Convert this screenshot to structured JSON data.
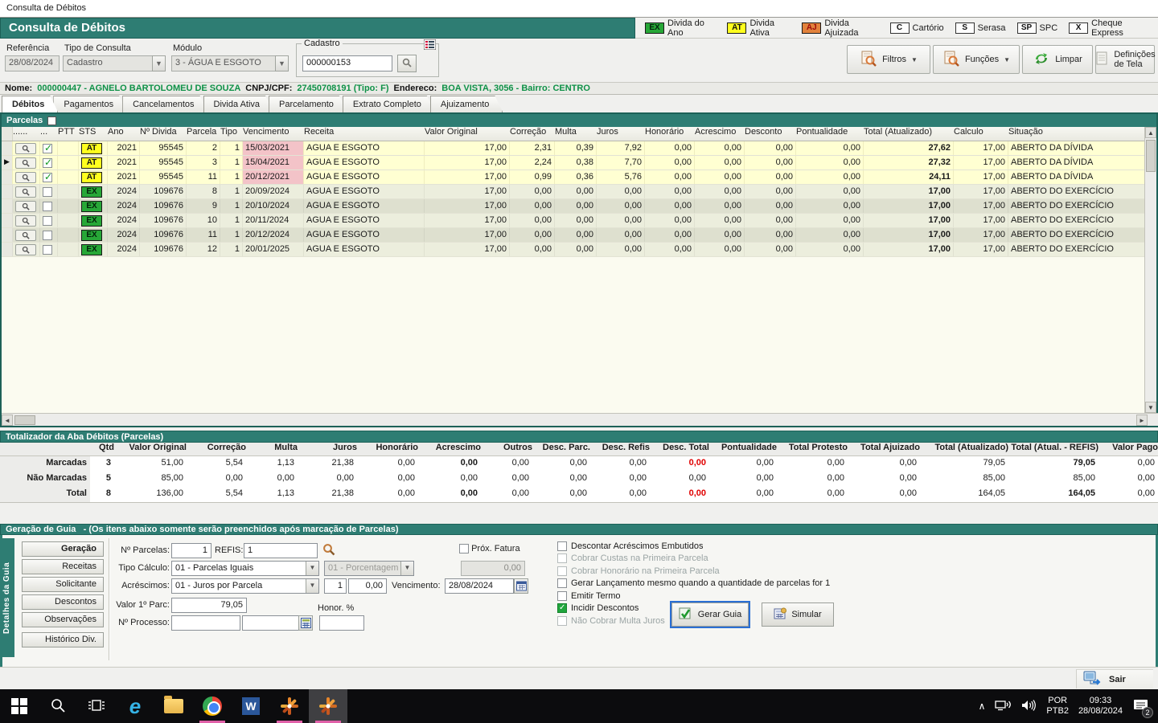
{
  "window": {
    "title": "Consulta de Débitos"
  },
  "header": {
    "title": "Consulta de Débitos",
    "legend": [
      {
        "code": "EX",
        "label": "Divida do Ano",
        "type": "ex"
      },
      {
        "code": "AT",
        "label": "Divida Ativa",
        "type": "at"
      },
      {
        "code": "AJ",
        "label": "Divida Ajuizada",
        "type": "aj"
      },
      {
        "code": "C",
        "label": "Cartório",
        "type": "plain"
      },
      {
        "code": "S",
        "label": "Serasa",
        "type": "plain"
      },
      {
        "code": "SP",
        "label": "SPC",
        "type": "plain"
      },
      {
        "code": "X",
        "label": "Cheque Express",
        "type": "plain"
      }
    ]
  },
  "filters": {
    "referencia_label": "Referência",
    "referencia_value": "28/08/2024",
    "tipo_consulta_label": "Tipo de Consulta",
    "tipo_consulta_value": "Cadastro",
    "modulo_label": "Módulo",
    "modulo_value": "3 - ÁGUA E ESGOTO",
    "cadastro_label": "Cadastro",
    "cadastro_value": "000000153"
  },
  "toolbar": {
    "filtros": "Filtros",
    "funcoes": "Funções",
    "limpar": "Limpar",
    "definicoes_l1": "Definições",
    "definicoes_l2": "de Tela"
  },
  "person": {
    "nome_label": "Nome:",
    "nome_value": "000000447 - AGNELO BARTOLOMEU DE SOUZA",
    "cnpj_label": "CNPJ/CPF:",
    "cnpj_value": "27450708191 (Tipo: F)",
    "endereco_label": "Endereco:",
    "endereco_value": "BOA VISTA, 3056 - Bairro: CENTRO"
  },
  "tabs": [
    {
      "label": "Débitos",
      "active": "true"
    },
    {
      "label": "Pagamentos",
      "active": "false"
    },
    {
      "label": "Cancelamentos",
      "active": "false"
    },
    {
      "label": "Divida Ativa",
      "active": "false"
    },
    {
      "label": "Parcelamento",
      "active": "false"
    },
    {
      "label": "Extrato Completo",
      "active": "false"
    },
    {
      "label": "Ajuizamento",
      "active": "false"
    }
  ],
  "parcelas": {
    "panel_label": "Parcelas",
    "columns": [
      "......",
      "...",
      "PTT",
      "STS",
      "Ano",
      "Nº Divida",
      "Parcela",
      "Tipo",
      "Vencimento",
      "Receita",
      "Valor Original",
      "Correção",
      "Multa",
      "Juros",
      "Honorário",
      "Acrescimo",
      "Desconto",
      "Pontualidade",
      "Total (Atualizado)",
      "Calculo",
      "Situação"
    ],
    "rows": [
      {
        "selected": "false",
        "checked": "true",
        "sts": "AT",
        "ano": "2021",
        "divida": "95545",
        "parcela": "2",
        "tipo": "1",
        "venc": "15/03/2021",
        "receita": "AGUA E ESGOTO",
        "vo": "17,00",
        "corr": "2,31",
        "multa": "0,39",
        "juros": "7,92",
        "hon": "0,00",
        "acr": "0,00",
        "desc": "0,00",
        "pont": "0,00",
        "total": "27,62",
        "calc": "17,00",
        "sit": "ABERTO DA DÍVIDA"
      },
      {
        "selected": "true",
        "checked": "true",
        "sts": "AT",
        "ano": "2021",
        "divida": "95545",
        "parcela": "3",
        "tipo": "1",
        "venc": "15/04/2021",
        "receita": "AGUA E ESGOTO",
        "vo": "17,00",
        "corr": "2,24",
        "multa": "0,38",
        "juros": "7,70",
        "hon": "0,00",
        "acr": "0,00",
        "desc": "0,00",
        "pont": "0,00",
        "total": "27,32",
        "calc": "17,00",
        "sit": "ABERTO DA DÍVIDA"
      },
      {
        "selected": "false",
        "checked": "true",
        "sts": "AT",
        "ano": "2021",
        "divida": "95545",
        "parcela": "11",
        "tipo": "1",
        "venc": "20/12/2021",
        "receita": "AGUA E ESGOTO",
        "vo": "17,00",
        "corr": "0,99",
        "multa": "0,36",
        "juros": "5,76",
        "hon": "0,00",
        "acr": "0,00",
        "desc": "0,00",
        "pont": "0,00",
        "total": "24,11",
        "calc": "17,00",
        "sit": "ABERTO DA DÍVIDA"
      },
      {
        "selected": "false",
        "checked": "false",
        "sts": "EX",
        "ano": "2024",
        "divida": "109676",
        "parcela": "8",
        "tipo": "1",
        "venc": "20/09/2024",
        "receita": "AGUA E ESGOTO",
        "vo": "17,00",
        "corr": "0,00",
        "multa": "0,00",
        "juros": "0,00",
        "hon": "0,00",
        "acr": "0,00",
        "desc": "0,00",
        "pont": "0,00",
        "total": "17,00",
        "calc": "17,00",
        "sit": "ABERTO DO EXERCÍCIO"
      },
      {
        "selected": "false",
        "checked": "false",
        "sts": "EX",
        "ano": "2024",
        "divida": "109676",
        "parcela": "9",
        "tipo": "1",
        "venc": "20/10/2024",
        "receita": "AGUA E ESGOTO",
        "vo": "17,00",
        "corr": "0,00",
        "multa": "0,00",
        "juros": "0,00",
        "hon": "0,00",
        "acr": "0,00",
        "desc": "0,00",
        "pont": "0,00",
        "total": "17,00",
        "calc": "17,00",
        "sit": "ABERTO DO EXERCÍCIO"
      },
      {
        "selected": "false",
        "checked": "false",
        "sts": "EX",
        "ano": "2024",
        "divida": "109676",
        "parcela": "10",
        "tipo": "1",
        "venc": "20/11/2024",
        "receita": "AGUA E ESGOTO",
        "vo": "17,00",
        "corr": "0,00",
        "multa": "0,00",
        "juros": "0,00",
        "hon": "0,00",
        "acr": "0,00",
        "desc": "0,00",
        "pont": "0,00",
        "total": "17,00",
        "calc": "17,00",
        "sit": "ABERTO DO EXERCÍCIO"
      },
      {
        "selected": "false",
        "checked": "false",
        "sts": "EX",
        "ano": "2024",
        "divida": "109676",
        "parcela": "11",
        "tipo": "1",
        "venc": "20/12/2024",
        "receita": "AGUA E ESGOTO",
        "vo": "17,00",
        "corr": "0,00",
        "multa": "0,00",
        "juros": "0,00",
        "hon": "0,00",
        "acr": "0,00",
        "desc": "0,00",
        "pont": "0,00",
        "total": "17,00",
        "calc": "17,00",
        "sit": "ABERTO DO EXERCÍCIO"
      },
      {
        "selected": "false",
        "checked": "false",
        "sts": "EX",
        "ano": "2024",
        "divida": "109676",
        "parcela": "12",
        "tipo": "1",
        "venc": "20/01/2025",
        "receita": "AGUA E ESGOTO",
        "vo": "17,00",
        "corr": "0,00",
        "multa": "0,00",
        "juros": "0,00",
        "hon": "0,00",
        "acr": "0,00",
        "desc": "0,00",
        "pont": "0,00",
        "total": "17,00",
        "calc": "17,00",
        "sit": "ABERTO DO EXERCÍCIO"
      }
    ]
  },
  "totalizador": {
    "title": "Totalizador da Aba Débitos (Parcelas)",
    "columns": [
      "Qtd",
      "Valor Original",
      "Correção",
      "Multa",
      "Juros",
      "Honorário",
      "Acrescimo",
      "Outros",
      "Desc. Parc.",
      "Desc. Refis",
      "Desc. Total",
      "Pontualidade",
      "Total Protesto",
      "Total Ajuizado",
      "Total (Atualizado)",
      "Total (Atual. - REFIS)",
      "Valor Pago"
    ],
    "rows": [
      {
        "label": "Marcadas",
        "qtd": "3",
        "vo": "51,00",
        "corr": "5,54",
        "multa": "1,13",
        "juros": "21,38",
        "hon": "0,00",
        "acr": "0,00",
        "outros": "0,00",
        "dparc": "0,00",
        "drefis": "0,00",
        "dtotal": "0,00",
        "red": "true",
        "emph": "true",
        "istotal": "false",
        "pont": "0,00",
        "tprot": "0,00",
        "tajz": "0,00",
        "tatual": "79,05",
        "trefis": "79,05",
        "vpago": "0,00"
      },
      {
        "label": "Não Marcadas",
        "qtd": "5",
        "vo": "85,00",
        "corr": "0,00",
        "multa": "0,00",
        "juros": "0,00",
        "hon": "0,00",
        "acr": "0,00",
        "outros": "0,00",
        "dparc": "0,00",
        "drefis": "0,00",
        "dtotal": "0,00",
        "red": "false",
        "emph": "false",
        "istotal": "false",
        "pont": "0,00",
        "tprot": "0,00",
        "tajz": "0,00",
        "tatual": "85,00",
        "trefis": "85,00",
        "vpago": "0,00"
      },
      {
        "label": "Total",
        "qtd": "8",
        "vo": "136,00",
        "corr": "5,54",
        "multa": "1,13",
        "juros": "21,38",
        "hon": "0,00",
        "acr": "0,00",
        "outros": "0,00",
        "dparc": "0,00",
        "drefis": "0,00",
        "dtotal": "0,00",
        "red": "true",
        "emph": "true",
        "istotal": "true",
        "pont": "0,00",
        "tprot": "0,00",
        "tajz": "0,00",
        "tatual": "164,05",
        "trefis": "164,05",
        "vpago": "0,00"
      }
    ]
  },
  "geracao": {
    "bar_title": "Geração de Guia",
    "bar_subtitle": "-   (Os itens abaixo somente serão preenchidos após marcação de Parcelas)",
    "side_tab": "Detalhes da Guia",
    "side_buttons": [
      "Geração",
      "Receitas",
      "Solicitante",
      "Descontos",
      "Observações",
      "Histórico Div."
    ],
    "fields": {
      "n_parcelas_label": "Nº Parcelas:",
      "n_parcelas_value": "1",
      "refis_label": "REFIS:",
      "refis_value": "1",
      "tipo_calculo_label": "Tipo Cálculo:",
      "tipo_calculo_value": "01 - Parcelas Iguais",
      "porcentagem_value": "01 - Porcentagem",
      "porcentagem_num": "0,00",
      "prox_fatura_label": "Próx. Fatura",
      "acrescimos_label": "Acréscimos:",
      "acrescimos_value": "01 - Juros por Parcela",
      "acrescimo_qtd": "1",
      "acrescimo_val": "0,00",
      "vencimento_label": "Vencimento:",
      "vencimento_value": "28/08/2024",
      "valor1_label": "Valor 1º Parc:",
      "valor1_value": "79,05",
      "honor_label": "Honor. %",
      "processo_label": "Nº Processo:"
    },
    "checkboxes": [
      {
        "label": "Descontar Acréscimos Embutidos",
        "checked": "false",
        "disabled": "false"
      },
      {
        "label": "Cobrar Custas na Primeira Parcela",
        "checked": "false",
        "disabled": "true"
      },
      {
        "label": "Cobrar Honorário na Primeira Parcela",
        "checked": "false",
        "disabled": "true"
      },
      {
        "label": "Gerar Lançamento mesmo quando a quantidade de parcelas for 1",
        "checked": "false",
        "disabled": "false"
      },
      {
        "label": "Emitir Termo",
        "checked": "false",
        "disabled": "false"
      },
      {
        "label": "Incidir Descontos",
        "checked": "true",
        "disabled": "false"
      },
      {
        "label": "Não Cobrar Multa Juros",
        "checked": "false",
        "disabled": "true"
      }
    ],
    "gerar_label": "Gerar Guia",
    "simular_label": "Simular"
  },
  "footer": {
    "sair": "Sair"
  },
  "taskbar": {
    "lang1": "POR",
    "lang2": "PTB2",
    "time": "09:33",
    "date": "28/08/2024",
    "notif_badge": "2"
  }
}
